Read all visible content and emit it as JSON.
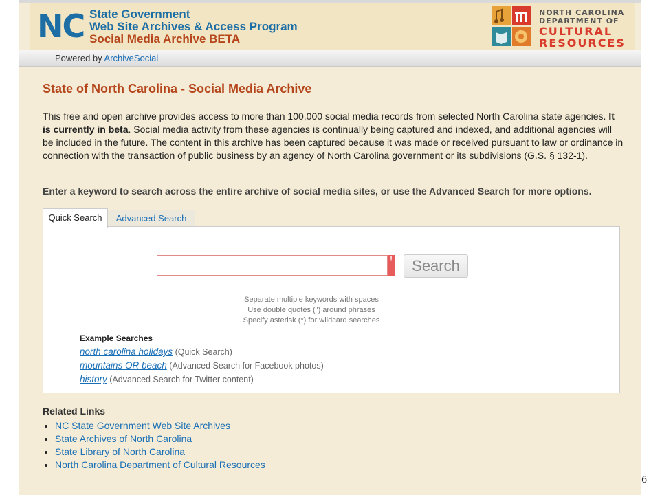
{
  "banner": {
    "nc_logo": "NC",
    "program_lines": [
      "State Government",
      "Web Site Archives & Access Program"
    ],
    "beta_line": "Social Media Archive BETA",
    "dcr_lines": [
      "NORTH CAROLINA",
      "DEPARTMENT OF"
    ],
    "dcr_big_lines": [
      "CULTURAL",
      "RESOURCES"
    ],
    "colors": {
      "nc_blue": "#1c6ea4",
      "accent_red": "#b5451b",
      "dcr_red": "#d83a2b"
    }
  },
  "powered": {
    "prefix": "Powered by ",
    "link": "ArchiveSocial"
  },
  "main": {
    "title": "State of North Carolina - Social Media Archive",
    "intro_part1": "This free and open archive provides access to more than 100,000 social media records from selected North Carolina state agencies. ",
    "intro_bold": "It is currently in beta",
    "intro_part2": ". Social media activity from these agencies is continually being captured and indexed, and additional agencies will be included in the future. The content in this archive has been captured because it was made or received pursuant to law or ordinance in connection with the transaction of public business by an agency of North Carolina government or its subdivisions (G.S. § 132-1).",
    "instruction": "Enter a keyword to search across the entire archive of social media sites, or use the Advanced Search for more options."
  },
  "tabs": [
    {
      "label": "Quick Search",
      "active": true
    },
    {
      "label": "Advanced Search",
      "active": false
    }
  ],
  "search": {
    "value": "",
    "error_flag": "!",
    "button_label": "Search",
    "hints": [
      "Separate multiple keywords with spaces",
      "Use double quotes (\") around phrases",
      "Specify asterisk (*) for wildcard searches"
    ]
  },
  "examples": {
    "heading": "Example Searches",
    "items": [
      {
        "link": "north carolina holidays",
        "note": " (Quick Search)"
      },
      {
        "link": "mountains OR beach",
        "note": " (Advanced Search for Facebook photos)"
      },
      {
        "link": "history",
        "note": " (Advanced Search for Twitter content)"
      }
    ]
  },
  "related": {
    "heading": "Related Links",
    "items": [
      "NC State Government Web Site Archives",
      "State Archives of North Carolina",
      "State Library of North Carolina",
      "North Carolina Department of Cultural Resources"
    ]
  },
  "page_number": "6"
}
